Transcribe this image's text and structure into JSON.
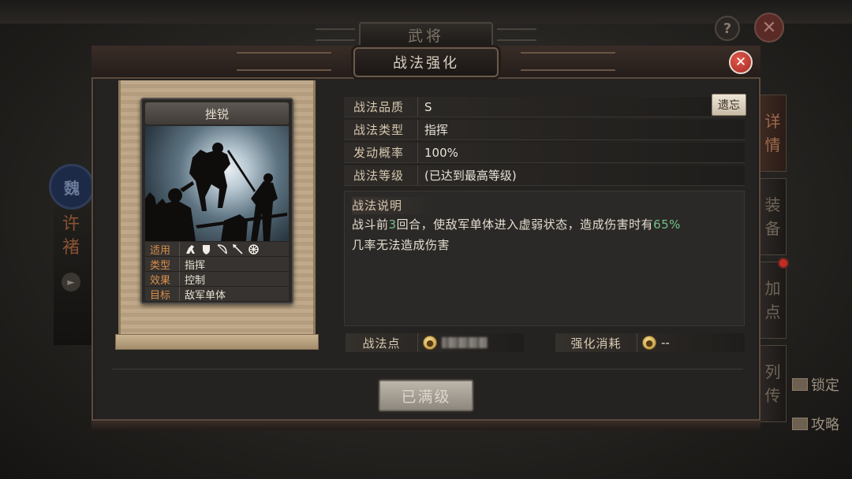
{
  "background": {
    "page_title": "武将",
    "help_label": "?",
    "close_label": "✕",
    "faction_label": "魏",
    "general_name": [
      "许",
      "褚"
    ],
    "side_tabs": [
      {
        "label": [
          "详",
          "情"
        ],
        "active": true
      },
      {
        "label": [
          "装",
          "备"
        ],
        "active": false
      },
      {
        "label": [
          "加",
          "点"
        ],
        "active": false
      },
      {
        "label": [
          "列",
          "传"
        ],
        "active": false
      }
    ],
    "lock_label": "锁定",
    "guide_label": "攻略"
  },
  "modal": {
    "title": "战法强化",
    "close_label": "✕",
    "card": {
      "name": "挫锐",
      "applicable_label": "适用",
      "applicable_units": [
        "cavalry-icon",
        "shield-icon",
        "bow-icon",
        "spear-icon",
        "vehicle-icon"
      ],
      "type_label": "类型",
      "type_value": "指挥",
      "effect_label": "效果",
      "effect_value": "控制",
      "target_label": "目标",
      "target_value": "敌军单体"
    },
    "attributes": [
      {
        "key": "战法品质",
        "value": "S"
      },
      {
        "key": "战法类型",
        "value": "指挥"
      },
      {
        "key": "发动概率",
        "value": "100%"
      },
      {
        "key": "战法等级",
        "value": "(已达到最高等级)"
      }
    ],
    "forget_button": "遗忘",
    "description": {
      "title": "战法说明",
      "text_before_turns": "战斗前",
      "turns": "3",
      "text_middle": "回合，使敌军单体进入虚弱状态，造成伤害时有",
      "chance": "65%",
      "text_after": "几率无法造成伤害"
    },
    "points": {
      "label": "战法点",
      "value_hidden": true
    },
    "cost": {
      "label": "强化消耗",
      "value": "--"
    },
    "max_button": "已满级"
  },
  "colors": {
    "highlight_green": "#74c08a",
    "close_red": "#c8342c",
    "label_orange": "#d88e4c"
  }
}
